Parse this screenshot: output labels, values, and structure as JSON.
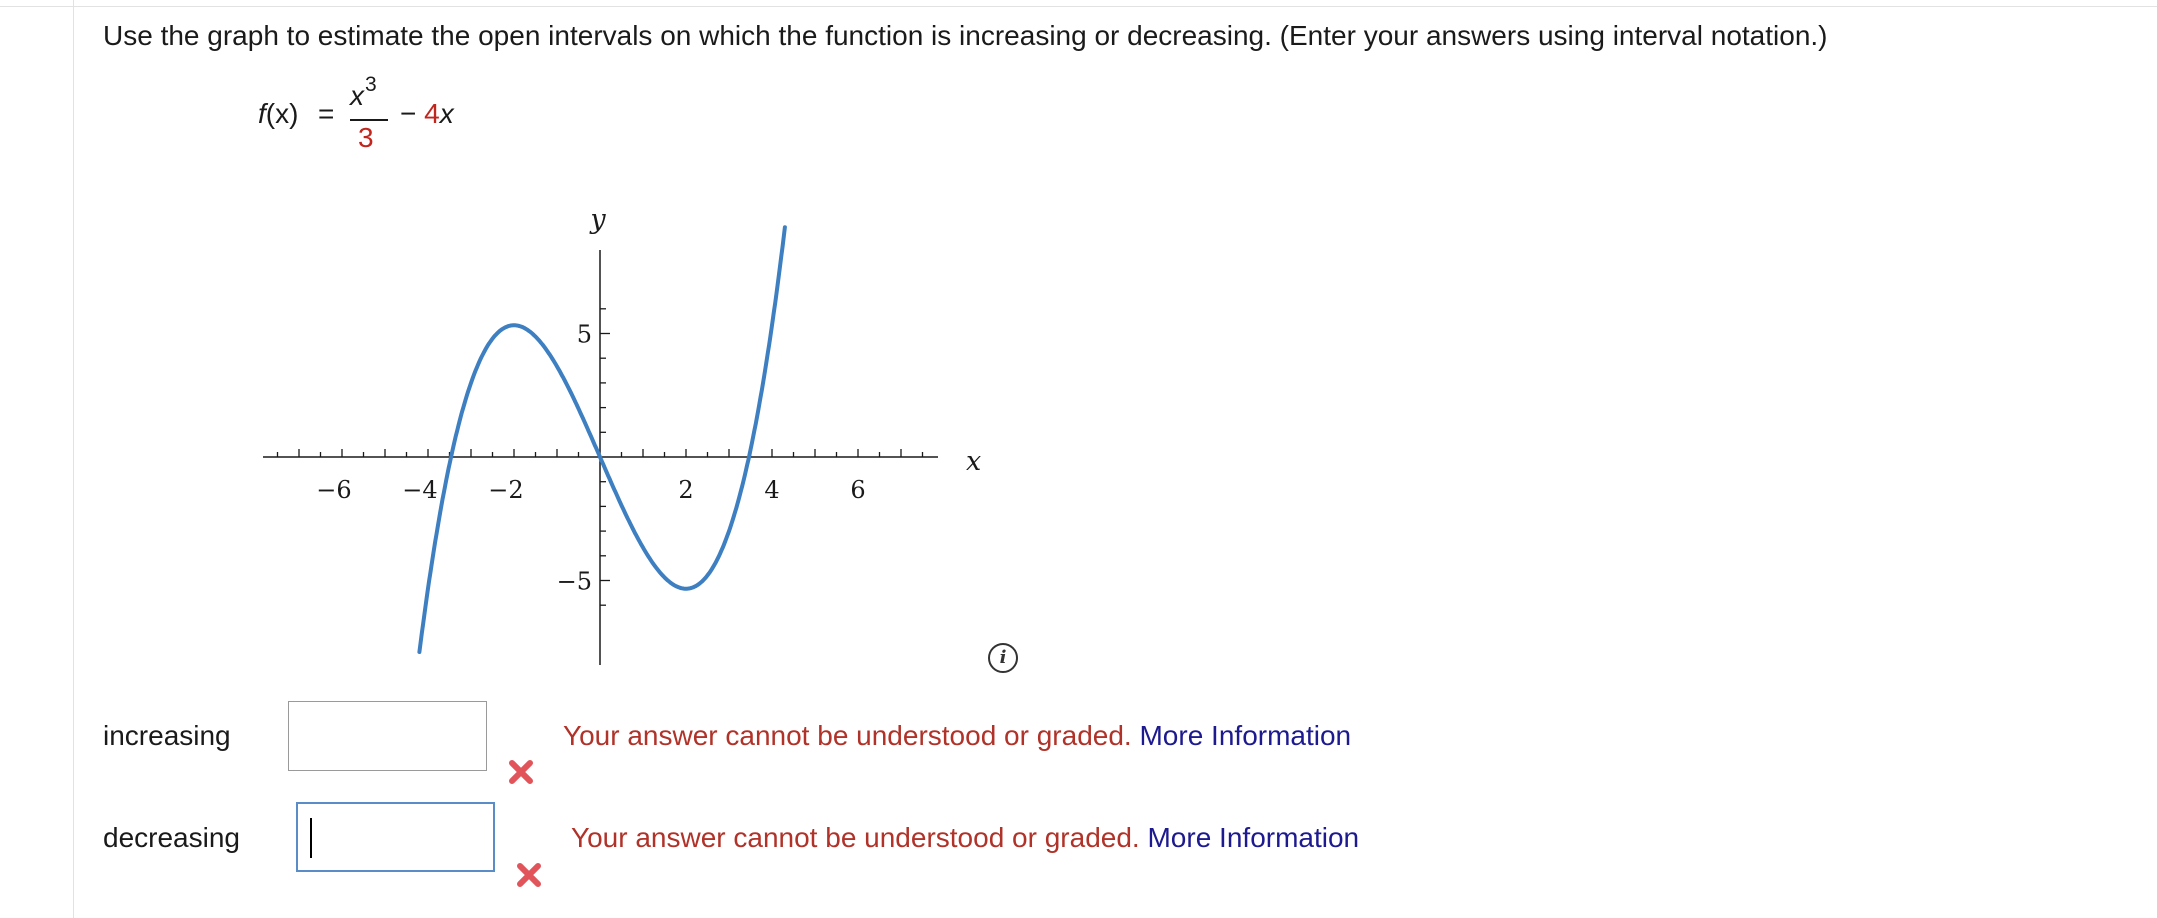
{
  "question": {
    "text": "Use the graph to estimate the open intervals on which the function is increasing or decreasing. (Enter your answers using interval notation.)"
  },
  "formula": {
    "lhs_name": "f",
    "lhs_arg": "(x)",
    "equals": "=",
    "numerator_var": "x",
    "numerator_exp": "3",
    "denominator": "3",
    "minus": "−",
    "coefficient": "4",
    "term_var": "x"
  },
  "graph": {
    "x_axis_label": "x",
    "y_axis_label": "y",
    "x_tick_labels": [
      {
        "value": -6,
        "text": "−6"
      },
      {
        "value": -4,
        "text": "−4"
      },
      {
        "value": -2,
        "text": "−2"
      },
      {
        "value": 2,
        "text": "2"
      },
      {
        "value": 4,
        "text": "4"
      },
      {
        "value": 6,
        "text": "6"
      }
    ],
    "y_tick_labels": [
      {
        "value": 5,
        "text": "5"
      },
      {
        "value": -5,
        "text": "−5"
      }
    ],
    "curve_color": "#3d7fc1",
    "x_range": [
      -8,
      8
    ],
    "y_range": [
      -8.5,
      8.5
    ]
  },
  "chart_data": {
    "type": "line",
    "series": [
      {
        "x": [
          -4.2,
          -4,
          -3,
          -2,
          -1,
          0,
          1,
          2,
          3,
          4,
          4.3
        ],
        "y": [
          -7.9,
          -5.33,
          3.0,
          5.33,
          3.67,
          0,
          -3.67,
          -5.33,
          -3.0,
          5.33,
          9.29
        ]
      }
    ],
    "xlabel": "x",
    "ylabel": "y",
    "xlim": [
      -8,
      8
    ],
    "ylim": [
      -8.5,
      8.5
    ],
    "grid": false
  },
  "answers": {
    "increasing": {
      "label": "increasing",
      "value": "",
      "feedback": "Your answer cannot be understood or graded.",
      "more_link": "More Information"
    },
    "decreasing": {
      "label": "decreasing",
      "value": "",
      "feedback": "Your answer cannot be understood or graded.",
      "more_link": "More Information"
    }
  },
  "colors": {
    "error_text": "#b03228",
    "link": "#1d1a8f",
    "x_mark": "#e0545a",
    "focus_border": "#5a8dc8"
  },
  "icons": {
    "info": "info-circle-icon",
    "incorrect": "x-mark-icon"
  }
}
